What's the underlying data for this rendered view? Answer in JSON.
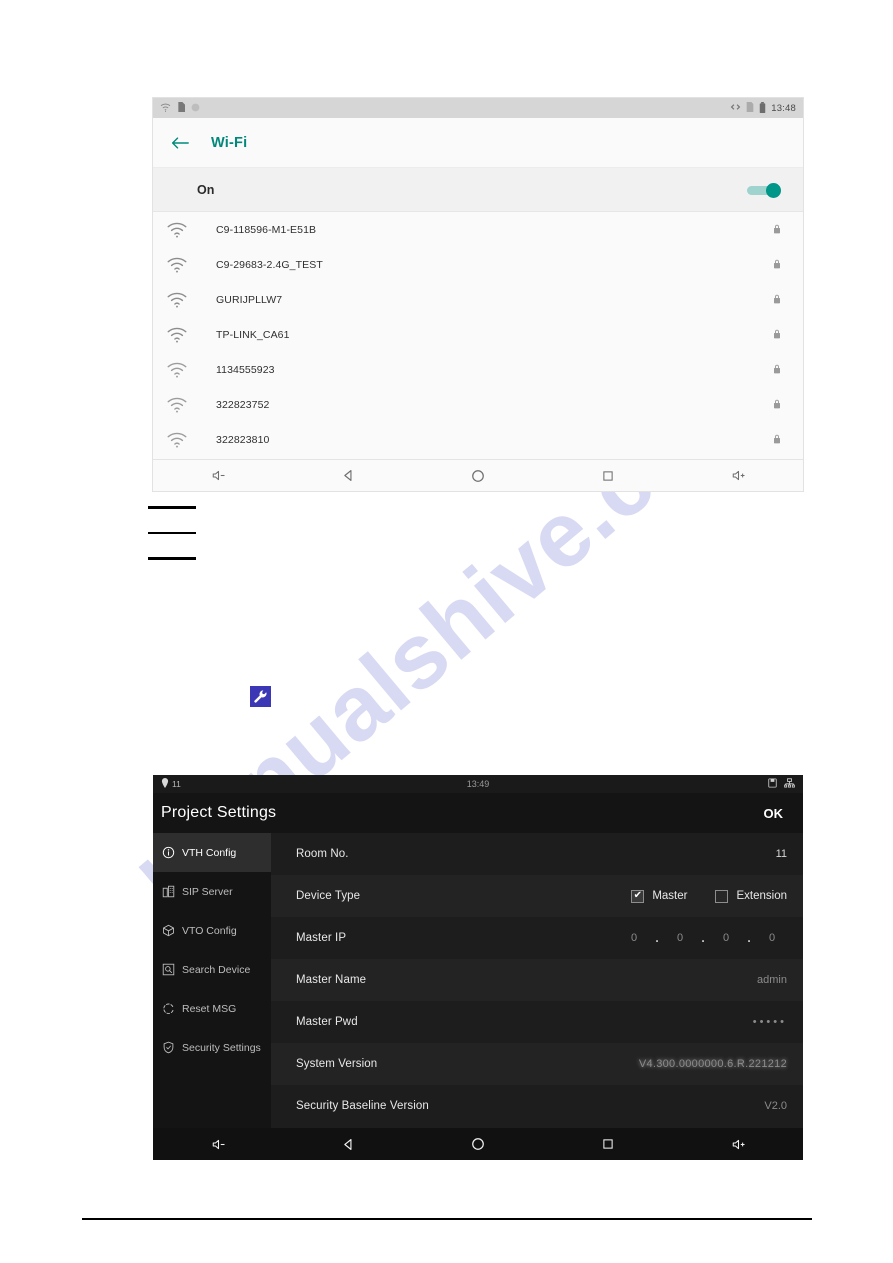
{
  "document": {
    "watermark": "manualshive.com",
    "redaction_bars": 3
  },
  "wifi_screen": {
    "status_bar": {
      "left_icons": [
        "wifi-icon",
        "sd-card-icon",
        "circle-icon"
      ],
      "right_icons": [
        "usb-debug-icon",
        "sim-icon",
        "battery-icon"
      ],
      "time": "13:48"
    },
    "app_bar": {
      "back_icon": "arrow-left-icon",
      "title": "Wi-Fi"
    },
    "toggle_row": {
      "label": "On",
      "enabled": true,
      "accent_color": "#009688"
    },
    "networks": [
      {
        "ssid": "C9-118596-M1-E51B",
        "secured": true
      },
      {
        "ssid": "C9-29683-2.4G_TEST",
        "secured": true
      },
      {
        "ssid": "GURIJPLLW7",
        "secured": true
      },
      {
        "ssid": "TP-LINK_CA61",
        "secured": true
      },
      {
        "ssid": "1134555923",
        "secured": true
      },
      {
        "ssid": "322823752",
        "secured": true
      },
      {
        "ssid": "322823810",
        "secured": true
      }
    ],
    "nav_bar": [
      "volume-down-icon",
      "back-icon",
      "home-icon",
      "recents-icon",
      "volume-up-icon"
    ]
  },
  "settings_screen": {
    "status_bar": {
      "room": "11",
      "location_icon": "location-pin-icon",
      "time": "13:49",
      "right_icons": [
        "sd-card-icon",
        "ethernet-icon"
      ]
    },
    "title_bar": {
      "title": "Project Settings",
      "ok_label": "OK"
    },
    "menu": [
      {
        "label": "VTH Config",
        "icon": "info-circle-icon",
        "active": true
      },
      {
        "label": "SIP Server",
        "icon": "server-icon",
        "active": false
      },
      {
        "label": "VTO Config",
        "icon": "box-icon",
        "active": false
      },
      {
        "label": "Search Device",
        "icon": "search-box-icon",
        "active": false
      },
      {
        "label": "Reset MSG",
        "icon": "reset-icon",
        "active": false
      },
      {
        "label": "Security Settings",
        "icon": "shield-icon",
        "active": false
      }
    ],
    "rows": {
      "room_no": {
        "label": "Room No.",
        "value": "11"
      },
      "device_type": {
        "label": "Device Type",
        "options": [
          {
            "label": "Master",
            "checked": true
          },
          {
            "label": "Extension",
            "checked": false
          }
        ]
      },
      "master_ip": {
        "label": "Master IP",
        "octets": [
          "0",
          "0",
          "0",
          "0"
        ],
        "separator": "."
      },
      "master_name": {
        "label": "Master Name",
        "value": "admin"
      },
      "master_pwd": {
        "label": "Master Pwd",
        "value": "•••••"
      },
      "system_version": {
        "label": "System Version",
        "value": "V4.300.0000000.6.R.221212"
      },
      "security_baseline_version": {
        "label": "Security Baseline Version",
        "value": "V2.0"
      }
    },
    "nav_bar": [
      "volume-down-icon",
      "back-icon",
      "home-icon",
      "recents-icon",
      "volume-up-icon"
    ]
  }
}
